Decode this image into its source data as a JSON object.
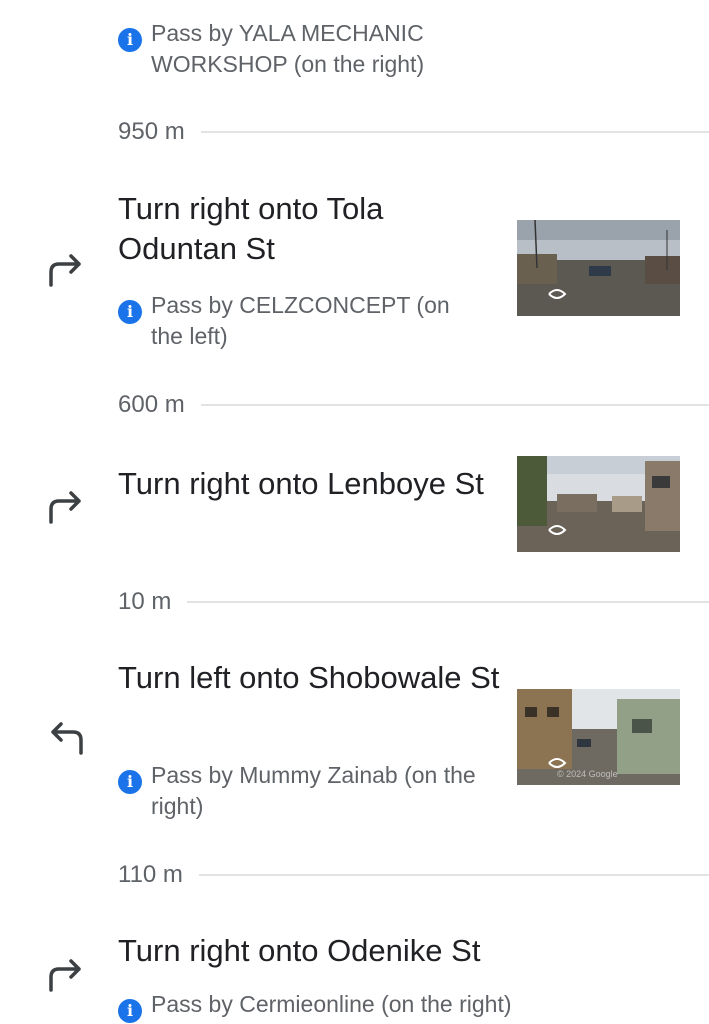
{
  "steps": [
    {
      "landmark": "Pass by YALA MECHANIC WORKSHOP (on the right)"
    },
    {
      "distance": "950 m",
      "instruction": "Turn right onto Tola Oduntan St",
      "direction_icon": "turn-right-icon",
      "landmark": "Pass by CELZCONCEPT (on the left)",
      "thumbnail": "street-view-thumbnail"
    },
    {
      "distance": "600 m",
      "instruction": "Turn right onto Lenboye St",
      "direction_icon": "turn-right-icon",
      "thumbnail": "street-view-thumbnail"
    },
    {
      "distance": "10 m",
      "instruction": "Turn left onto Shobowale St",
      "direction_icon": "turn-left-icon",
      "landmark": "Pass by Mummy Zainab (on the right)",
      "thumbnail": "street-view-thumbnail",
      "thumbnail_watermark": "© 2024 Google"
    },
    {
      "distance": "110 m",
      "instruction": "Turn right onto Odenike St",
      "direction_icon": "turn-right-icon",
      "landmark": "Pass by Cermieonline (on the right)"
    }
  ],
  "colors": {
    "info_icon": "#1a73e8",
    "primary_text": "#202124",
    "secondary_text": "#5f6368",
    "divider": "#e3e3e3"
  }
}
